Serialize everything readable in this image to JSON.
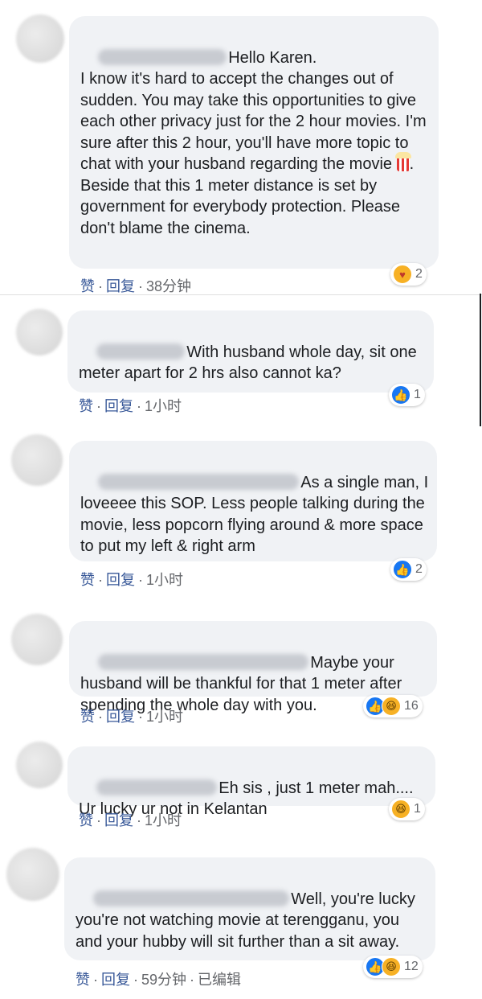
{
  "comments": [
    {
      "text": "Hello Karen.\nI know it's hard to accept the changes out of sudden. You may take this opportunities to give each other privacy just for the 2 hour movies. I'm sure after this 2 hour, you'll have more topic to chat with your husband regarding the movie",
      "text2": ".\nBeside that this 1 meter distance is set by government for everybody protection. Please don't blame the cinema.",
      "like": "赞",
      "reply": "回复",
      "time": "38分钟",
      "reactions": [
        "care-icon"
      ],
      "reaction_count": "2"
    },
    {
      "text": "With husband whole day, sit one meter apart for 2 hrs also cannot ka?",
      "like": "赞",
      "reply": "回复",
      "time": "1小时",
      "reactions": [
        "like-icon"
      ],
      "reaction_count": "1"
    },
    {
      "text": "As a single man, I loveeee this SOP. Less people talking during the movie, less popcorn flying around & more space to put my left & right arm",
      "like": "赞",
      "reply": "回复",
      "time": "1小时",
      "reactions": [
        "like-icon"
      ],
      "reaction_count": "2"
    },
    {
      "text": "Maybe your husband will be thankful for that 1 meter after spending the whole day with you.",
      "like": "赞",
      "reply": "回复",
      "time": "1小时",
      "reactions": [
        "like-icon",
        "haha-icon"
      ],
      "reaction_count": "16"
    },
    {
      "text": "Eh sis , just 1 meter mah.... Ur lucky ur not in Kelantan",
      "like": "赞",
      "reply": "回复",
      "time": "1小时",
      "reactions": [
        "haha-icon"
      ],
      "reaction_count": "1"
    },
    {
      "text": "Well, you're lucky you're not watching movie at terengganu, you and your hubby will sit further than a sit away.",
      "like": "赞",
      "reply": "回复",
      "time": "59分钟",
      "edited": "已编辑",
      "reactions": [
        "like-icon",
        "haha-icon"
      ],
      "reaction_count": "12"
    }
  ],
  "colors": {
    "bubble": "#f0f2f5",
    "link": "#385898",
    "meta": "#65676b",
    "like_blue": "#1877f2",
    "haha_yellow": "#f7b125"
  }
}
